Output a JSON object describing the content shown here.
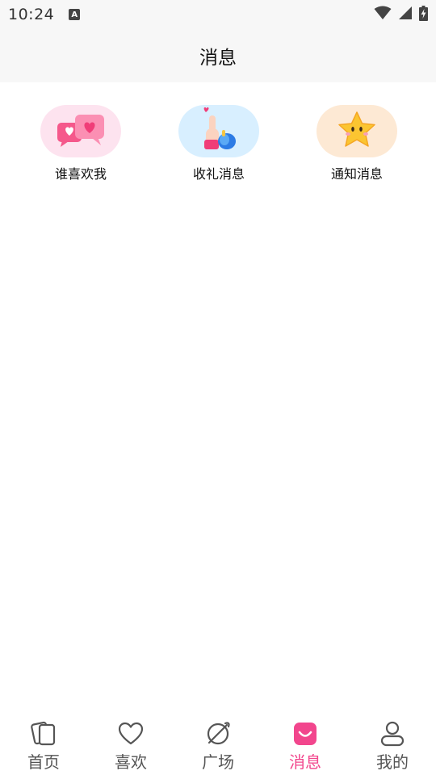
{
  "status_bar": {
    "time": "10:24",
    "indicator": "A",
    "icons": [
      "wifi-icon",
      "signal-icon",
      "battery-charging-icon"
    ]
  },
  "header": {
    "title": "消息"
  },
  "shortcuts": [
    {
      "label": "谁喜欢我",
      "icon": "hearts-chat-icon",
      "color": "#fde3ef"
    },
    {
      "label": "收礼消息",
      "icon": "gift-hand-icon",
      "color": "#d8efff"
    },
    {
      "label": "通知消息",
      "icon": "star-icon",
      "color": "#fde9d4"
    }
  ],
  "bottom_nav": {
    "active_index": 3,
    "active_color": "#f2468d",
    "items": [
      {
        "label": "首页",
        "icon": "cards-icon"
      },
      {
        "label": "喜欢",
        "icon": "heart-icon"
      },
      {
        "label": "广场",
        "icon": "planet-icon"
      },
      {
        "label": "消息",
        "icon": "message-smile-icon"
      },
      {
        "label": "我的",
        "icon": "person-icon"
      }
    ]
  }
}
